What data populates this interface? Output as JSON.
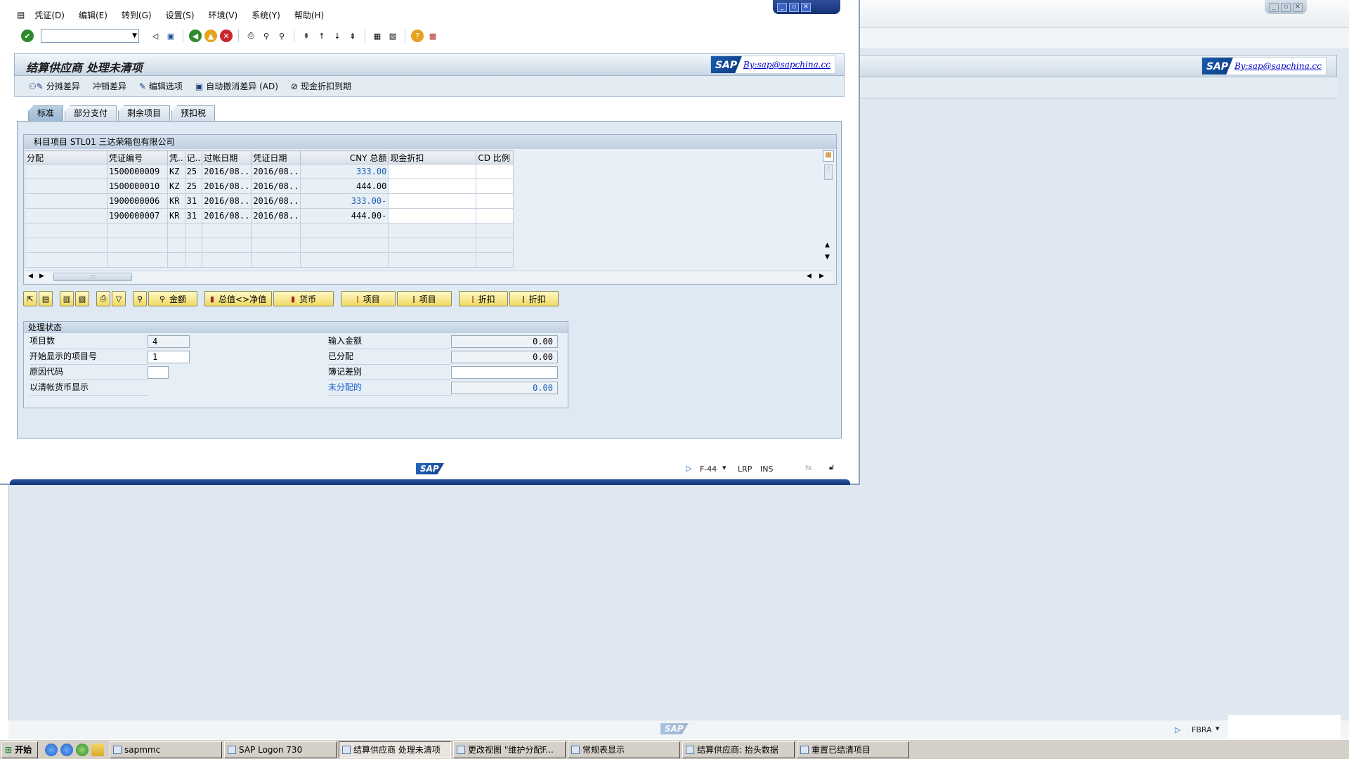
{
  "menu": [
    "凭证(D)",
    "编辑(E)",
    "转到(G)",
    "设置(S)",
    "环境(V)",
    "系统(Y)",
    "帮助(H)"
  ],
  "page_title": "结算供应商 处理未清项",
  "sap_logo": "SAP",
  "by_link": "By:sap@sapchina.cc",
  "app_toolbar": [
    {
      "label": "分摊差异",
      "icon": "distribute-icon"
    },
    {
      "label": "冲销差异",
      "icon": "none"
    },
    {
      "label": "编辑选项",
      "icon": "pencil-icon"
    },
    {
      "label": "自动撤消差异 (AD)",
      "icon": "save-icon"
    },
    {
      "label": "现金折扣到期",
      "icon": "no-entry-icon"
    }
  ],
  "tabs": [
    "标准",
    "部分支付",
    "剩余项目",
    "预扣税"
  ],
  "grid": {
    "title": "科目项目 STL01 三达荣箱包有限公司",
    "columns": [
      "分配",
      "凭证编号",
      "凭..",
      "记..",
      "过帐日期",
      "凭证日期",
      "CNY 总额",
      "现金折扣",
      "CD 比例"
    ],
    "rows": [
      {
        "assign": "",
        "doc": "1500000009",
        "type": "KZ",
        "pk": "25",
        "post": "2016/08..",
        "docdate": "2016/08..",
        "amount": "333.00",
        "disc": "",
        "cd": "",
        "blue": true
      },
      {
        "assign": "",
        "doc": "1500000010",
        "type": "KZ",
        "pk": "25",
        "post": "2016/08..",
        "docdate": "2016/08..",
        "amount": "444.00",
        "disc": "",
        "cd": "",
        "blue": false
      },
      {
        "assign": "",
        "doc": "1900000006",
        "type": "KR",
        "pk": "31",
        "post": "2016/08..",
        "docdate": "2016/08..",
        "amount": "333.00-",
        "disc": "",
        "cd": "",
        "blue": true
      },
      {
        "assign": "",
        "doc": "1900000007",
        "type": "KR",
        "pk": "31",
        "post": "2016/08..",
        "docdate": "2016/08..",
        "amount": "444.00-",
        "disc": "",
        "cd": "",
        "blue": false
      }
    ]
  },
  "action_buttons": {
    "amount": "金额",
    "gross_net": "总值<>净值",
    "currency": "货币",
    "item1": "项目",
    "item2": "项目",
    "disc1": "折扣",
    "disc2": "折扣"
  },
  "status": {
    "header": "处理状态",
    "items_label": "项目数",
    "items_value": "4",
    "start_label": "开始显示的项目号",
    "start_value": "1",
    "reason_label": "原因代码",
    "reason_value": "",
    "clearing_label": "以清帐货币显示",
    "entered_label": "输入金额",
    "entered_value": "0.00",
    "assigned_label": "已分配",
    "assigned_value": "0.00",
    "diff_label": "簿记差别",
    "diff_value": "",
    "unassigned_label": "未分配的",
    "unassigned_value": "0.00"
  },
  "statusbar": {
    "tcode": "F-44",
    "server": "LRP",
    "mode": "INS"
  },
  "bg_statusbar": {
    "tcode": "FBRA"
  },
  "taskbar": {
    "start": "开始",
    "tasks": [
      "sapmmc",
      "SAP Logon 730",
      "结算供应商 处理未清项",
      "更改视图 \"维护分配F...",
      "常规表显示",
      "结算供应商: 抬头数据",
      "重置已结清项目"
    ]
  },
  "colors": {
    "accent": "#1b60b5",
    "yellow_btn": "#f0d962",
    "panel": "#dfe9f3"
  }
}
